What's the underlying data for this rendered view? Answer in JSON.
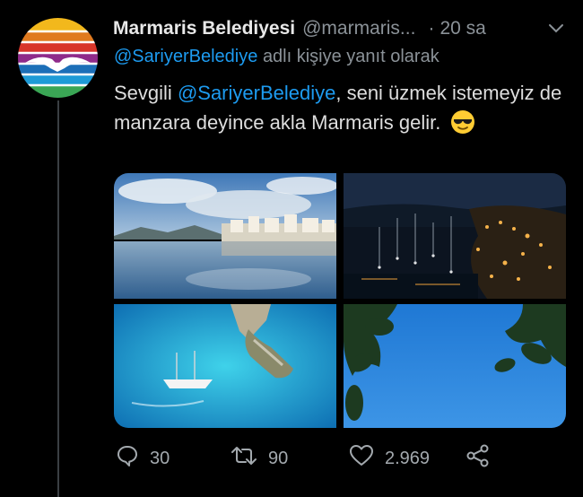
{
  "tweet": {
    "display_name": "Marmaris Belediyesi",
    "handle": "@marmaris...",
    "separator": "·",
    "time": "20 sa",
    "reply_handle": "@SariyerBelediye",
    "reply_suffix": "adlı kişiye yanıt olarak",
    "text_part1": "Sevgili",
    "mention": "@SariyerBelediye",
    "text_part2": ", seni üzmek istemeyiz de manzara deyince akla Marmaris gelir.",
    "emoji": "sunglasses-face-emoji"
  },
  "media": {
    "photos": [
      "harbor-reflection-photo",
      "night-marina-photo",
      "turquoise-sea-boat-photo",
      "sky-leaves-photo"
    ]
  },
  "actions": {
    "replies": "30",
    "retweets": "90",
    "likes": "2.969"
  },
  "colors": {
    "accent": "#1d9bf0",
    "muted": "#8b9298",
    "background": "#000000"
  }
}
